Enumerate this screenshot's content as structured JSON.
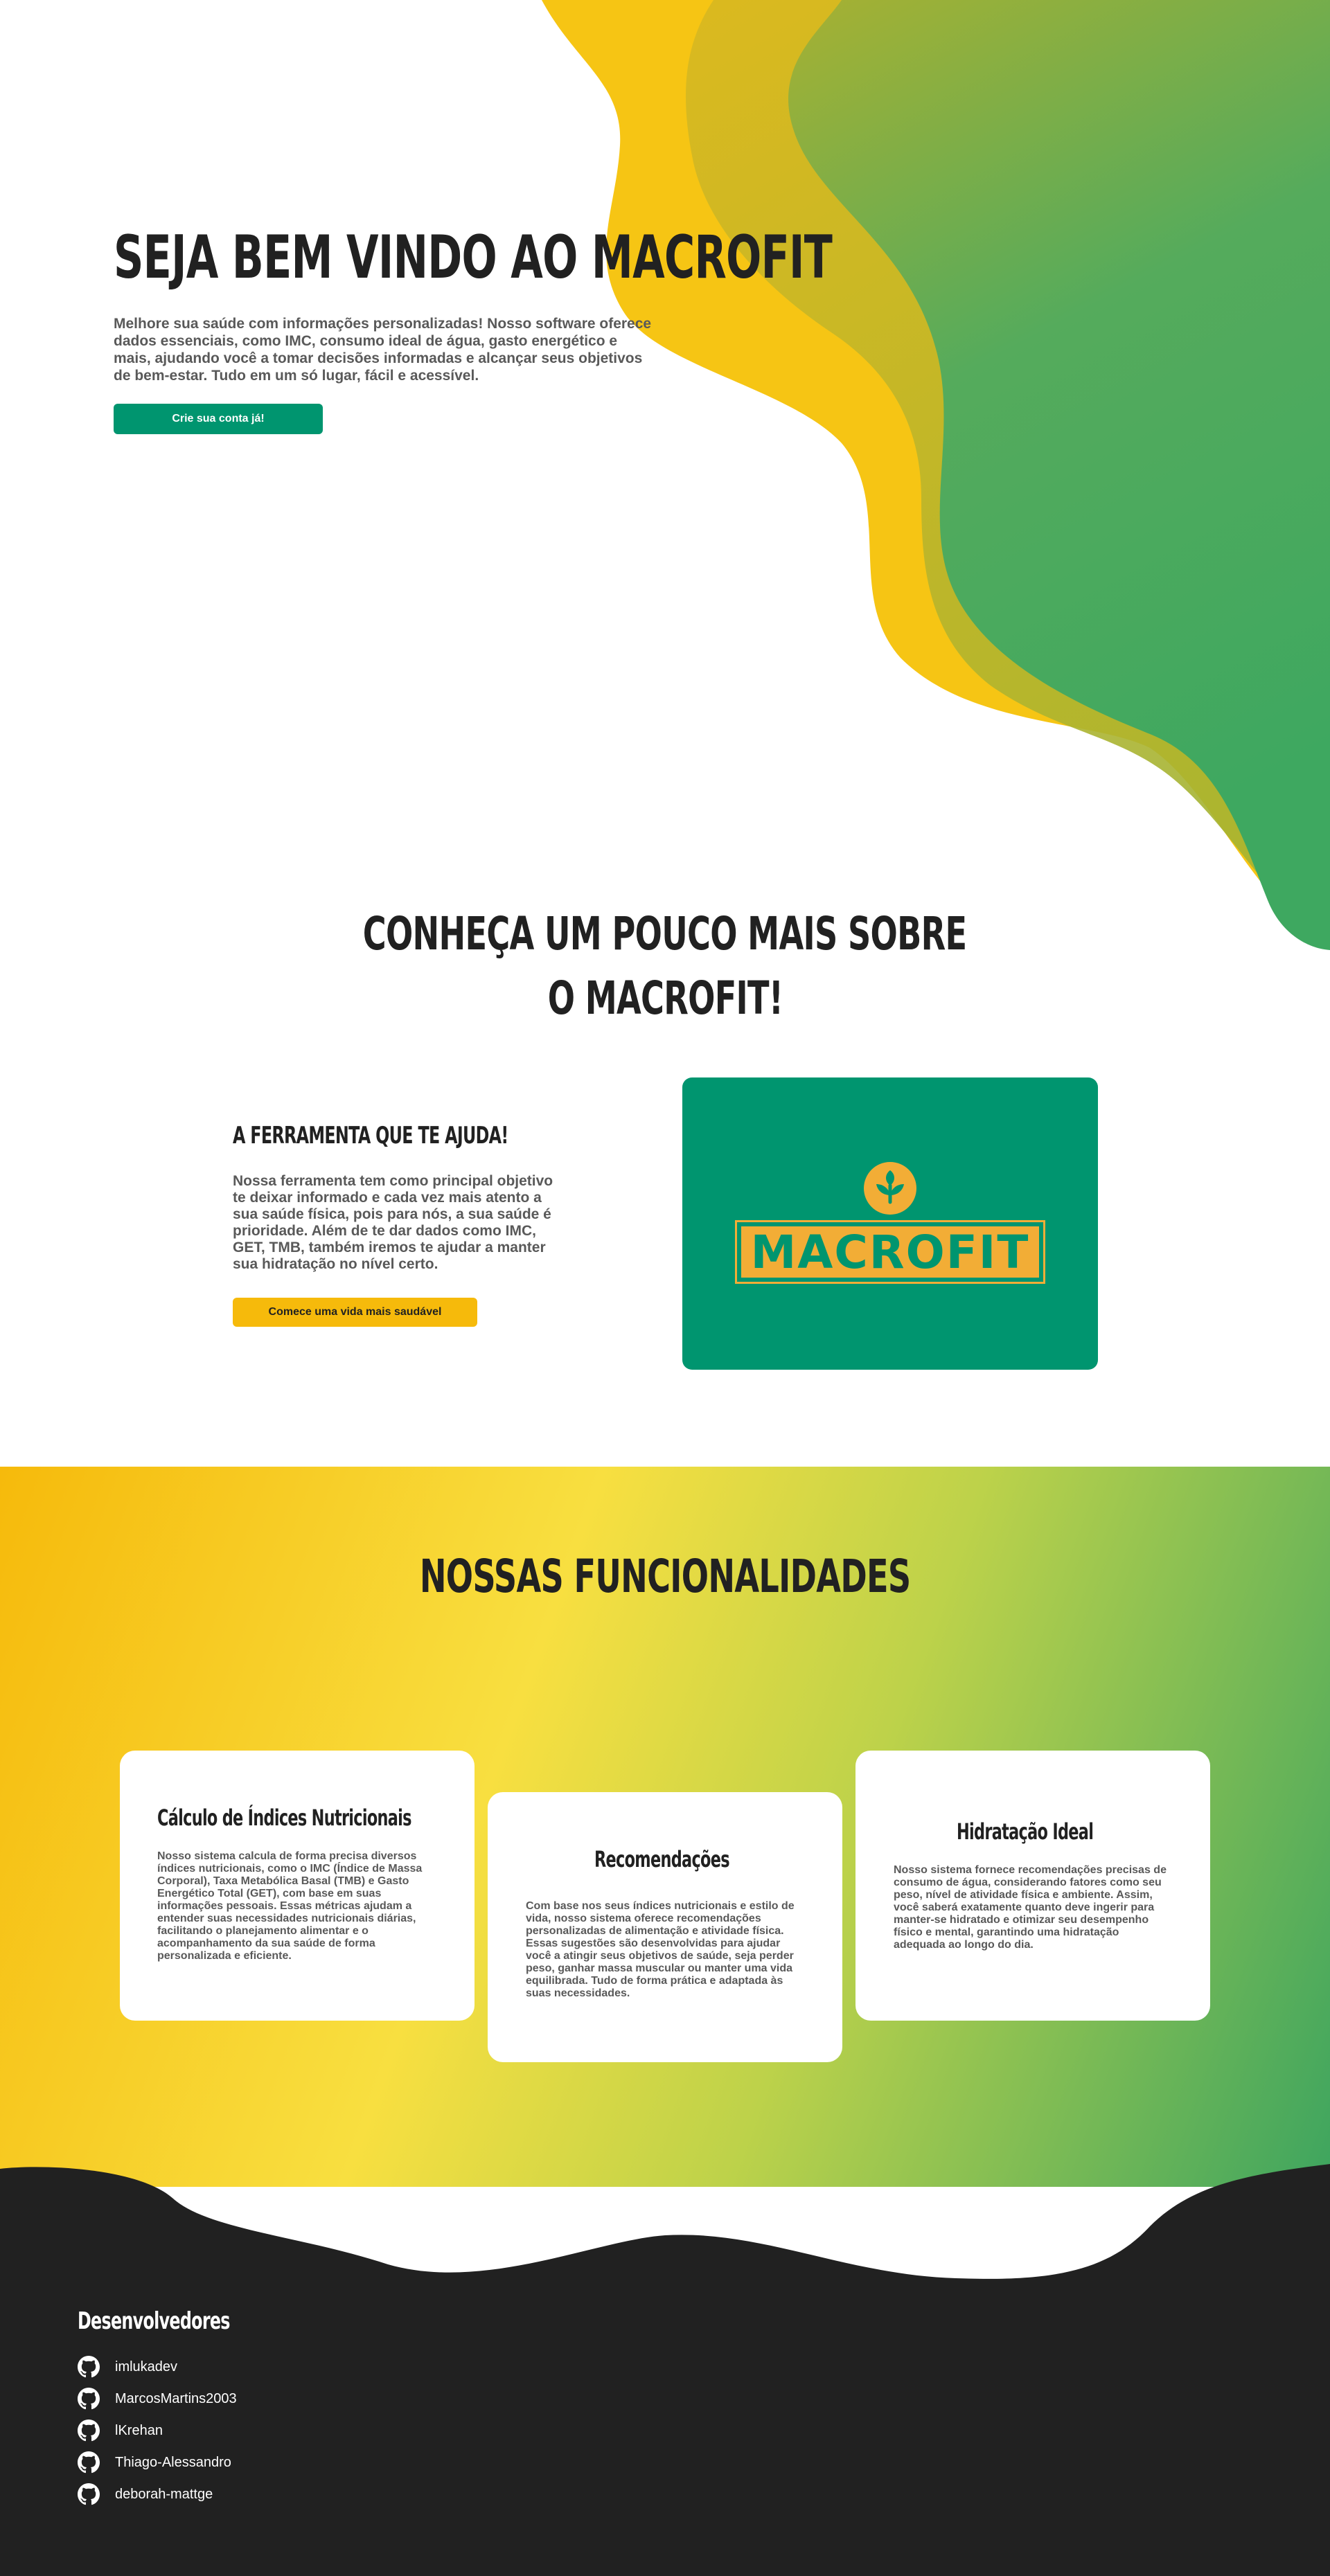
{
  "hero": {
    "title": "SEJA BEM VINDO AO MACROFIT",
    "text": "Melhore sua saúde com informações personalizadas! Nosso software oferece dados essenciais, como IMC, consumo ideal de água, gasto energético e mais, ajudando você a tomar decisões informadas e alcançar seus objetivos de bem-estar. Tudo em um só lugar, fácil e acessível.",
    "cta": "Crie sua conta já!",
    "colors": {
      "yellow": "#f6c514",
      "green": "#3ea860",
      "button": "#00956f"
    }
  },
  "about": {
    "title_line1": "CONHEÇA UM POUCO MAIS SOBRE",
    "title_line2": "O MACROFIT!",
    "subtitle": "A FERRAMENTA QUE TE AJUDA!",
    "text": "Nossa ferramenta tem como principal objetivo te deixar informado e cada vez mais atento a sua saúde física, pois para nós, a sua saúde é prioridade. Além de te dar dados como IMC, GET, TMB, também iremos te ajudar a manter sua hidratação no nível certo.",
    "cta": "Comece uma vida mais saudável",
    "logo": {
      "word": "MACROFIT",
      "icon": "leaf-icon",
      "bg": "#00956f",
      "accent": "#f2ad36"
    }
  },
  "features": {
    "title": "NOSSAS FUNCIONALIDADES",
    "cards": [
      {
        "title": "Cálculo de Índices Nutricionais",
        "text": "Nosso sistema calcula de forma precisa diversos índices nutricionais, como o IMC (Índice de Massa Corporal), Taxa Metabólica Basal (TMB) e Gasto Energético Total (GET), com base em suas informações pessoais. Essas métricas ajudam a entender suas necessidades nutricionais diárias, facilitando o planejamento alimentar e o acompanhamento da sua saúde de forma personalizada e eficiente."
      },
      {
        "title": "Recomendações",
        "text": "Com base nos seus índices nutricionais e estilo de vida, nosso sistema oferece recomendações personalizadas de alimentação e atividade física. Essas sugestões são desenvolvidas para ajudar você a atingir seus objetivos de saúde, seja perder peso, ganhar massa muscular ou manter uma vida equilibrada. Tudo de forma prática e adaptada às suas necessidades."
      },
      {
        "title": "Hidratação Ideal",
        "text": "Nosso sistema fornece recomendações precisas de consumo de água, considerando fatores como seu peso, nível de atividade física e ambiente. Assim, você saberá exatamente quanto deve ingerir para manter-se hidratado e otimizar seu desempenho físico e mental, garantindo uma hidratação adequada ao longo do dia."
      }
    ]
  },
  "footer": {
    "title": "Desenvolvedores",
    "icon": "github-icon",
    "bg": "#212121",
    "developers": [
      "imlukadev",
      "MarcosMartins2003",
      "lKrehan",
      "Thiago-Alessandro",
      "deborah-mattge"
    ]
  }
}
